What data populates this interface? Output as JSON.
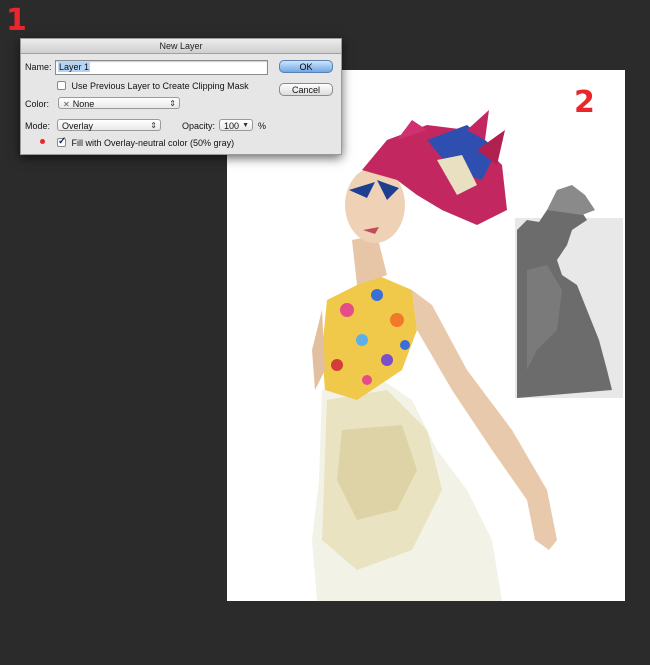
{
  "steps": {
    "one": "1",
    "two": "2"
  },
  "dialog": {
    "title": "New Layer",
    "name_label": "Name:",
    "name_value": "Layer 1",
    "clipping_label": "Use Previous Layer to Create Clipping Mask",
    "clipping_checked": false,
    "color_label": "Color:",
    "color_value": "None",
    "mode_label": "Mode:",
    "mode_value": "Overlay",
    "opacity_label": "Opacity:",
    "opacity_value": "100",
    "opacity_unit": "%",
    "fill_label": "Fill with Overlay-neutral color (50% gray)",
    "fill_checked": true,
    "ok_label": "OK",
    "cancel_label": "Cancel"
  },
  "colors": {
    "accent_red": "#e8262c",
    "background": "#2b2b2b",
    "ok_blue": "#6fa8e8"
  }
}
